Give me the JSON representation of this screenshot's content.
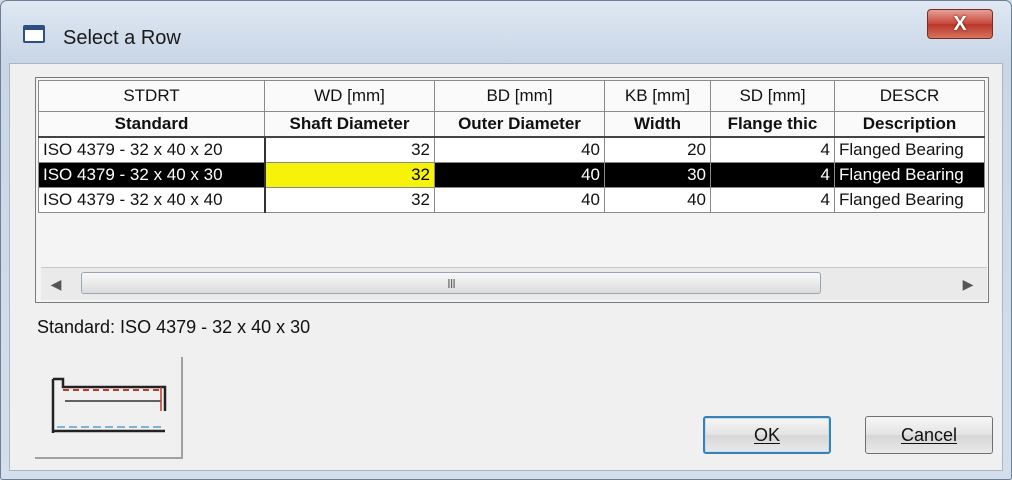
{
  "window": {
    "title": "Select a Row",
    "close_label": "X"
  },
  "grid": {
    "code_headers": [
      "STDRT",
      "WD [mm]",
      "BD [mm]",
      "KB [mm]",
      "SD [mm]",
      "DESCR"
    ],
    "title_headers": [
      "Standard",
      "Shaft Diameter",
      "Outer Diameter",
      "Width",
      "Flange thic",
      "Description"
    ],
    "rows": [
      [
        "ISO 4379 - 32 x 40 x 20",
        "32",
        "40",
        "20",
        "4",
        "Flanged Bearing"
      ],
      [
        "ISO 4379 - 32 x 40 x 30",
        "32",
        "40",
        "30",
        "4",
        "Flanged Bearing"
      ],
      [
        "ISO 4379 - 32 x 40 x 40",
        "32",
        "40",
        "40",
        "4",
        "Flanged Bearing"
      ]
    ],
    "selected_row_index": 1,
    "scroll_thumb_label": "III"
  },
  "status": {
    "text": "Standard: ISO 4379 - 32 x 40 x 30"
  },
  "buttons": {
    "ok_label": "OK",
    "cancel_label": "Cancel"
  },
  "colors": {
    "selection": "#000000",
    "current_cell": "#f7f20a",
    "close": "#c9463a",
    "default_button_border": "#3c7fb1"
  },
  "icons": {
    "title": "window-icon",
    "preview": "flanged-bearing-preview-icon"
  }
}
